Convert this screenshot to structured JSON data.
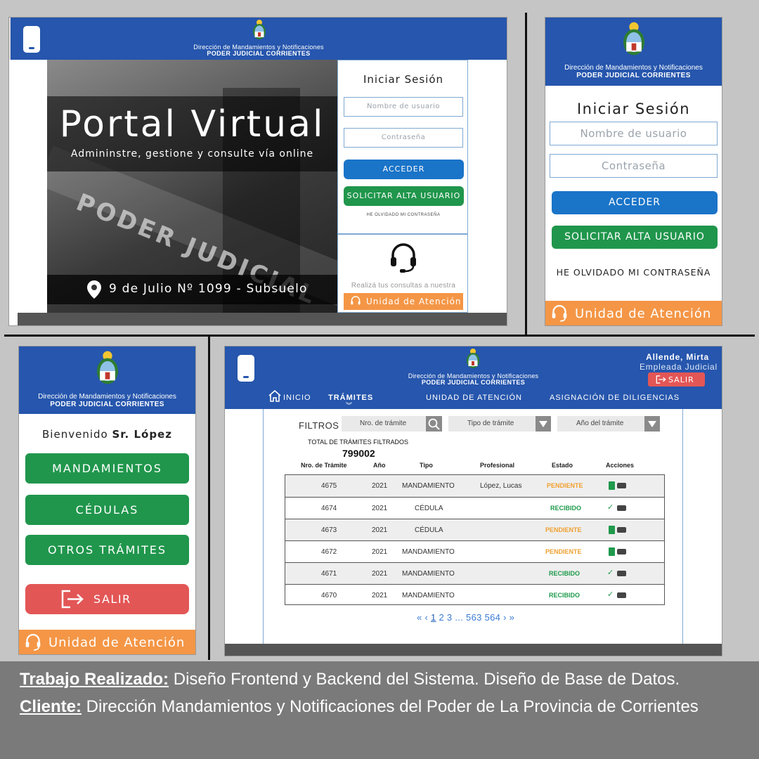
{
  "header": {
    "org_line1": "Dirección de Mandamientos y Notificaciones",
    "org_line2": "PODER JUDICIAL CORRIENTES"
  },
  "desktop_login": {
    "hero_title": "Portal Virtual",
    "hero_subtitle": "Admininstre, gestione y consulte vía online",
    "address": "9 de Julio Nº 1099 - Subsuelo",
    "login_title": "Iniciar Sesión",
    "username_placeholder": "Nombre de usuario",
    "password_placeholder": "Contraseña",
    "login_button": "ACCEDER",
    "signup_button": "SOLICITAR ALTA USUARIO",
    "forgot_link": "HE OLVIDADO MI CONTRASEÑA",
    "support_text": "Realizá tus consultas a nuestra",
    "support_button": "Unidad de Atención"
  },
  "mobile_login": {
    "login_title": "Iniciar Sesión",
    "username_placeholder": "Nombre de usuario",
    "password_placeholder": "Contraseña",
    "login_button": "ACCEDER",
    "signup_button": "SOLICITAR ALTA USUARIO",
    "forgot_link": "HE OLVIDADO MI CONTRASEÑA",
    "support_button": "Unidad de Atención"
  },
  "mobile_menu": {
    "welcome_prefix": "Bienvenido",
    "welcome_name": "Sr. López",
    "items": [
      "MANDAMIENTOS",
      "CÉDULAS",
      "OTROS TRÁMITES"
    ],
    "logout_button": "SALIR",
    "support_button": "Unidad de Atención"
  },
  "dashboard": {
    "user_name": "Allende, Mirta",
    "user_role": "Empleada Judicial",
    "logout_button": "SALIR",
    "nav": [
      "INICIO",
      "TRÁMITES",
      "UNIDAD DE ATENCIÓN",
      "ASIGNACIÓN DE DILIGENCIAS"
    ],
    "filters_label": "FILTROS",
    "filter_number_placeholder": "Nro. de trámite",
    "filter_type": "Tipo de trámite",
    "filter_year": "Año del trámite",
    "total_label": "TOTAL DE TRÁMITES FILTRADOS",
    "total_value": "799002",
    "columns": [
      "Nro. de Trámite",
      "Año",
      "Tipo",
      "Profesional",
      "Estado",
      "Acciones"
    ],
    "rows": [
      {
        "nro": "4675",
        "anio": "2021",
        "tipo": "MANDAMIENTO",
        "profesional": "López, Lucas",
        "estado": "PENDIENTE"
      },
      {
        "nro": "4674",
        "anio": "2021",
        "tipo": "CÉDULA",
        "profesional": "",
        "estado": "RECIBIDO"
      },
      {
        "nro": "4673",
        "anio": "2021",
        "tipo": "CÉDULA",
        "profesional": "",
        "estado": "PENDIENTE"
      },
      {
        "nro": "4672",
        "anio": "2021",
        "tipo": "MANDAMIENTO",
        "profesional": "",
        "estado": "PENDIENTE"
      },
      {
        "nro": "4671",
        "anio": "2021",
        "tipo": "MANDAMIENTO",
        "profesional": "",
        "estado": "RECIBIDO"
      },
      {
        "nro": "4670",
        "anio": "2021",
        "tipo": "MANDAMIENTO",
        "profesional": "",
        "estado": "RECIBIDO"
      }
    ],
    "pagination": {
      "pages": [
        "1",
        "2",
        "3"
      ],
      "ellipsis": "...",
      "last_pages": [
        "563",
        "564"
      ]
    }
  },
  "caption": {
    "work_label": "Trabajo Realizado:",
    "work_text": " Diseño Frontend y Backend del Sistema. Diseño de Base de Datos.",
    "client_label": "Cliente:",
    "client_text": " Dirección Mandamientos y Notificaciones del Poder de La Provincia de Corrientes"
  },
  "colors": {
    "header_blue": "#2656ad",
    "button_blue": "#1a74c8",
    "button_green": "#20964c",
    "button_red": "#e35656",
    "accent_orange": "#f49646",
    "pending": "#f0a030",
    "received": "#1f9a4c"
  }
}
